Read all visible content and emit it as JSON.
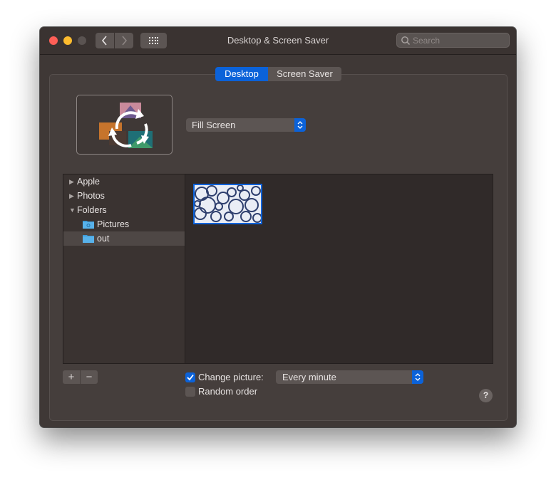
{
  "window": {
    "title": "Desktop & Screen Saver"
  },
  "search": {
    "placeholder": "Search"
  },
  "tabs": [
    {
      "label": "Desktop",
      "selected": true
    },
    {
      "label": "Screen Saver",
      "selected": false
    }
  ],
  "fill_mode": {
    "selected": "Fill Screen"
  },
  "sidebar": {
    "items": [
      {
        "label": "Apple",
        "expanded": false
      },
      {
        "label": "Photos",
        "expanded": false
      },
      {
        "label": "Folders",
        "expanded": true
      },
      {
        "label": "Pictures",
        "icon": "folder-icon"
      },
      {
        "label": "out",
        "icon": "folder-icon",
        "selected": true
      }
    ]
  },
  "options": {
    "change_picture_label": "Change picture:",
    "change_picture_checked": true,
    "interval": "Every minute",
    "random_order_label": "Random order",
    "random_order_checked": false
  },
  "buttons": {
    "add": "+",
    "remove": "−",
    "help": "?"
  },
  "colors": {
    "accent": "#0b62d9",
    "window_bg": "#3f3836"
  }
}
